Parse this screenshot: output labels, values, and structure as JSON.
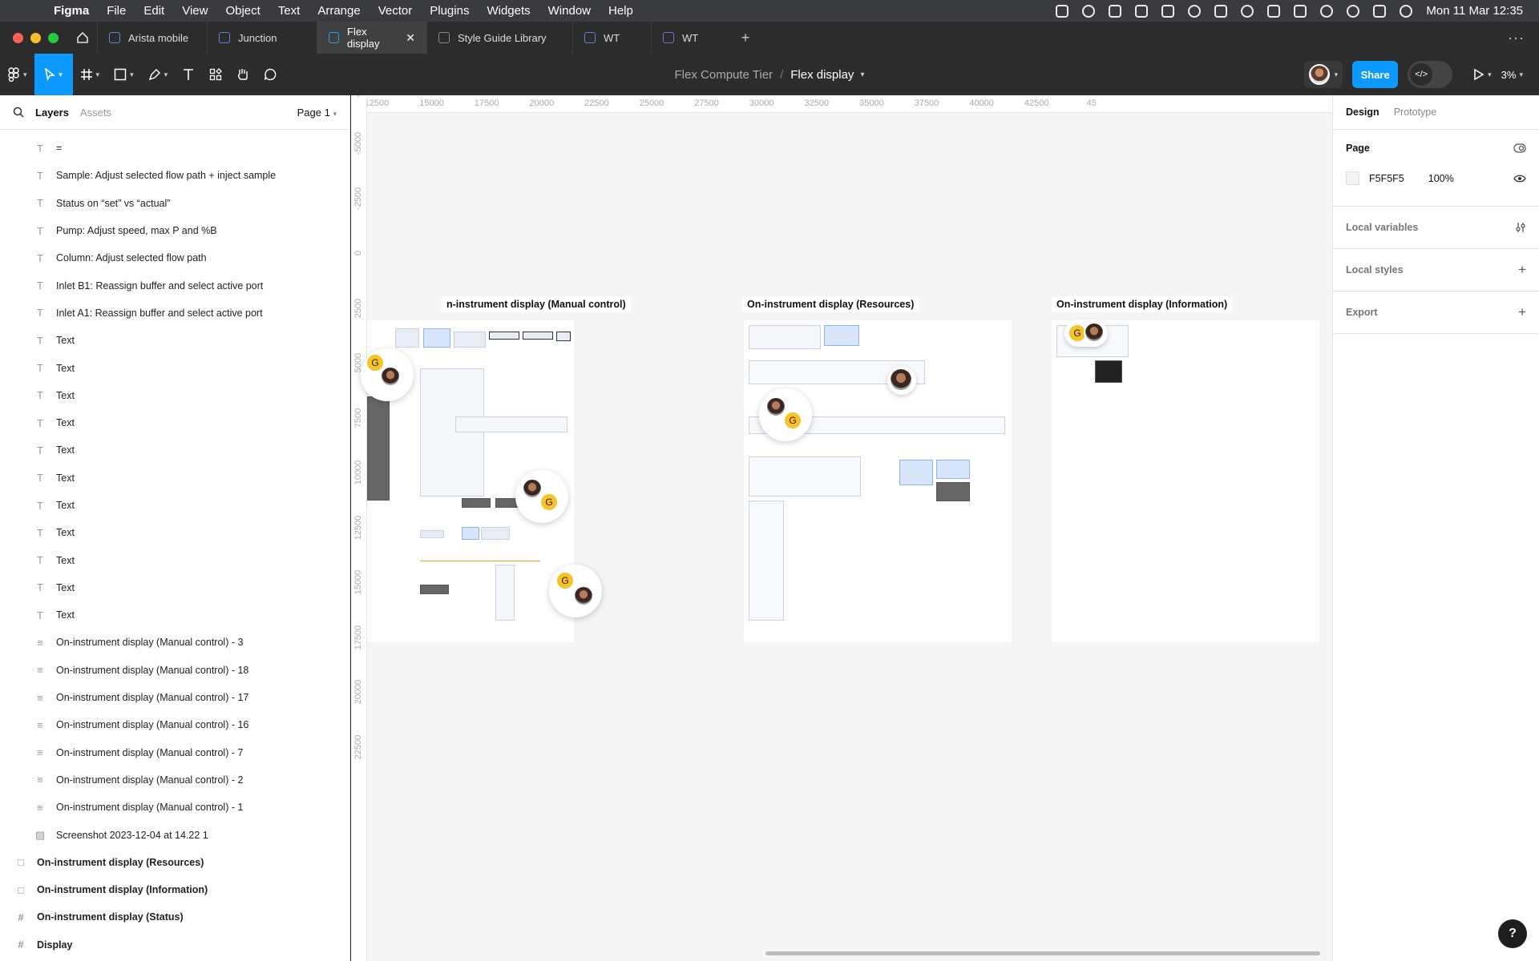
{
  "menubar": {
    "app": "Figma",
    "items": [
      "File",
      "Edit",
      "View",
      "Object",
      "Text",
      "Arrange",
      "Vector",
      "Plugins",
      "Widgets",
      "Window",
      "Help"
    ],
    "datetime": "Mon 11 Mar  12:35"
  },
  "tabs": [
    {
      "label": "Arista mobile",
      "icon": "figma-file-icon"
    },
    {
      "label": "Junction",
      "icon": "figma-file-icon"
    },
    {
      "label": "Flex display",
      "icon": "figma-file-icon",
      "active": true
    },
    {
      "label": "Style Guide Library",
      "icon": "figma-file-icon"
    },
    {
      "label": "WT",
      "icon": "figma-file-icon"
    },
    {
      "label": "WT",
      "icon": "figjam-file-icon"
    }
  ],
  "toolbar": {
    "project": "Flex Compute Tier",
    "separator": "/",
    "file": "Flex display",
    "share_label": "Share",
    "zoom": "3%"
  },
  "left_panel": {
    "tab_layers": "Layers",
    "tab_assets": "Assets",
    "page": "Page 1",
    "layers": [
      {
        "icon": "T",
        "name": "=",
        "level": 1
      },
      {
        "icon": "T",
        "name": "Sample: Adjust selected flow path + inject sample",
        "level": 1
      },
      {
        "icon": "T",
        "name": "Status on “set” vs “actual”",
        "level": 1
      },
      {
        "icon": "T",
        "name": "Pump: Adjust speed, max P and %B",
        "level": 1
      },
      {
        "icon": "T",
        "name": "Column: Adjust selected flow path",
        "level": 1
      },
      {
        "icon": "T",
        "name": "Inlet B1: Reassign buffer and select active port",
        "level": 1
      },
      {
        "icon": "T",
        "name": "Inlet A1: Reassign buffer and select active port",
        "level": 1
      },
      {
        "icon": "T",
        "name": "Text",
        "level": 1
      },
      {
        "icon": "T",
        "name": "Text",
        "level": 1
      },
      {
        "icon": "T",
        "name": "Text",
        "level": 1
      },
      {
        "icon": "T",
        "name": "Text",
        "level": 1
      },
      {
        "icon": "T",
        "name": "Text",
        "level": 1
      },
      {
        "icon": "T",
        "name": "Text",
        "level": 1
      },
      {
        "icon": "T",
        "name": "Text",
        "level": 1
      },
      {
        "icon": "T",
        "name": "Text",
        "level": 1
      },
      {
        "icon": "T",
        "name": "Text",
        "level": 1
      },
      {
        "icon": "T",
        "name": "Text",
        "level": 1
      },
      {
        "icon": "T",
        "name": "Text",
        "level": 1
      },
      {
        "icon": "≡",
        "name": "On-instrument display (Manual control) - 3",
        "level": 1
      },
      {
        "icon": "≡",
        "name": "On-instrument display (Manual control) - 18",
        "level": 1
      },
      {
        "icon": "≡",
        "name": "On-instrument display (Manual control) - 17",
        "level": 1
      },
      {
        "icon": "≡",
        "name": "On-instrument display (Manual control) - 16",
        "level": 1
      },
      {
        "icon": "≡",
        "name": "On-instrument display (Manual control) - 7",
        "level": 1
      },
      {
        "icon": "≡",
        "name": "On-instrument display (Manual control) - 2",
        "level": 1
      },
      {
        "icon": "≡",
        "name": "On-instrument display (Manual control) - 1",
        "level": 1
      },
      {
        "icon": "▨",
        "name": "Screenshot 2023-12-04 at 14.22 1",
        "level": 1
      },
      {
        "icon": "□",
        "name": "On-instrument display (Resources)",
        "level": 0
      },
      {
        "icon": "□",
        "name": "On-instrument display (Information)",
        "level": 0
      },
      {
        "icon": "#",
        "name": "On-instrument display (Status)",
        "level": 0
      },
      {
        "icon": "#",
        "name": "Display",
        "level": 0
      }
    ]
  },
  "canvas": {
    "ruler_x": [
      "12500",
      "15000",
      "17500",
      "20000",
      "22500",
      "25000",
      "27500",
      "30000",
      "32500",
      "35000",
      "37500",
      "40000",
      "42500",
      "45"
    ],
    "ruler_y": [
      "-7",
      "-5000",
      "-2500",
      "0",
      "2500",
      "5000",
      "7500",
      "10000",
      "12500",
      "15000",
      "17500",
      "20000",
      "22500"
    ],
    "frames": [
      "n-instrument display (Manual control)",
      "On-instrument display (Resources)",
      "On-instrument display (Information)"
    ],
    "collab_initial": "G"
  },
  "right_panel": {
    "tab_design": "Design",
    "tab_prototype": "Prototype",
    "page_label": "Page",
    "page_color": "F5F5F5",
    "page_opacity": "100%",
    "local_variables": "Local variables",
    "local_styles": "Local styles",
    "export": "Export"
  },
  "help": "?"
}
